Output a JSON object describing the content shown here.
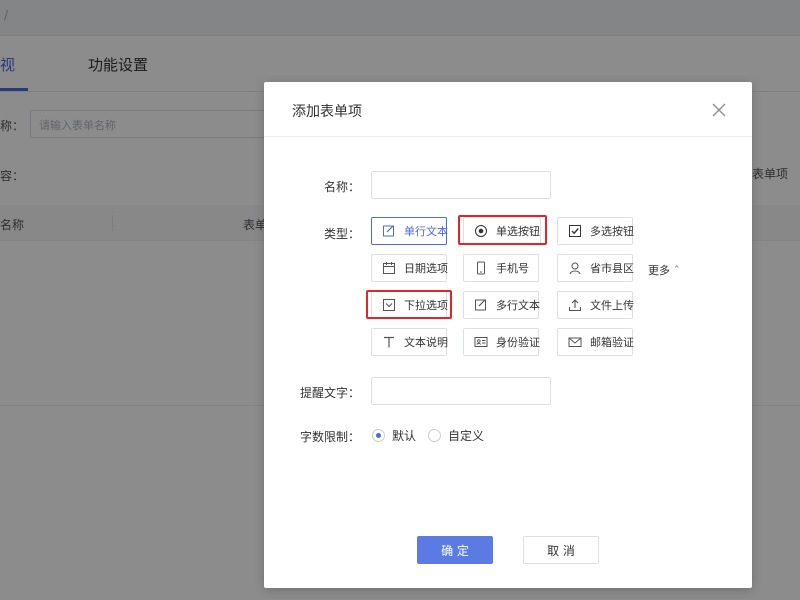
{
  "background": {
    "breadcrumb_slash": "/",
    "tabs": [
      {
        "label": "视",
        "active": true
      },
      {
        "label": "功能设置",
        "active": false
      }
    ],
    "name_label": "称：",
    "name_placeholder": "请输入表单名称",
    "content_label": "容：",
    "add_item_button": "加表单项",
    "table_headers": [
      "名称",
      "表单"
    ]
  },
  "modal": {
    "title": "添加表单项",
    "name_label": "名称：",
    "name_value": "",
    "type_label": "类型：",
    "types": [
      {
        "label": "单行文本",
        "icon": "edit-icon",
        "selected": true
      },
      {
        "label": "单选按钮",
        "icon": "radio-icon",
        "selected": false,
        "highlighted": true
      },
      {
        "label": "多选按钮",
        "icon": "checkbox-icon",
        "selected": false
      },
      {
        "label": "日期选项",
        "icon": "calendar-icon",
        "selected": false
      },
      {
        "label": "手机号",
        "icon": "phone-icon",
        "selected": false
      },
      {
        "label": "省市县区",
        "icon": "location-icon",
        "selected": false
      },
      {
        "label": "下拉选项",
        "icon": "dropdown-icon",
        "selected": false,
        "highlighted": true
      },
      {
        "label": "多行文本",
        "icon": "edit-icon",
        "selected": false
      },
      {
        "label": "文件上传",
        "icon": "upload-icon",
        "selected": false
      },
      {
        "label": "文本说明",
        "icon": "text-icon",
        "selected": false
      },
      {
        "label": "身份验证",
        "icon": "id-card-icon",
        "selected": false
      },
      {
        "label": "邮箱验证",
        "icon": "mail-icon",
        "selected": false
      }
    ],
    "more_label": "更多",
    "hint_label": "提醒文字：",
    "hint_value": "",
    "limit_label": "字数限制：",
    "limit_options": [
      {
        "label": "默认",
        "checked": true
      },
      {
        "label": "自定义",
        "checked": false
      }
    ],
    "confirm_label": "确 定",
    "cancel_label": "取 消"
  },
  "colors": {
    "accent": "#4a6bdc",
    "primary_button": "#5b7be3",
    "highlight_border": "#e0262d",
    "overlay": "rgba(0,0,0,0.45)"
  }
}
